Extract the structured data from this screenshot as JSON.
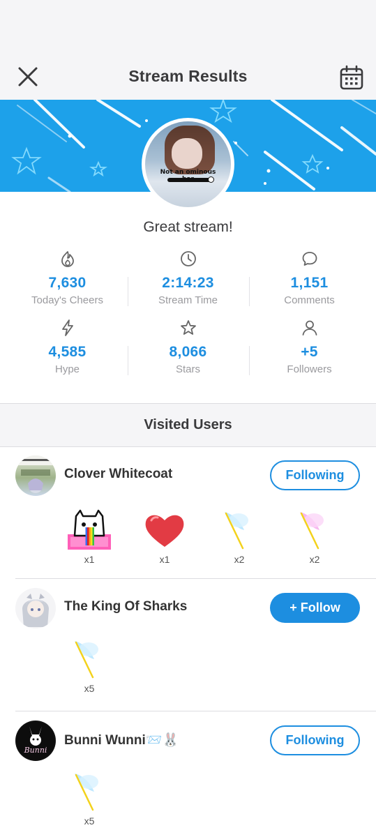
{
  "header": {
    "title": "Stream Results",
    "close_icon": "close-icon",
    "calendar_icon": "calendar-icon"
  },
  "banner": {
    "color": "#1da1ea"
  },
  "streamer": {
    "avatar_caption": "Not an ominous bar"
  },
  "summary": {
    "message": "Great stream!"
  },
  "stats": [
    {
      "icon": "flame-icon",
      "value": "7,630",
      "label": "Today's Cheers"
    },
    {
      "icon": "clock-icon",
      "value": "2:14:23",
      "label": "Stream Time"
    },
    {
      "icon": "comment-icon",
      "value": "1,151",
      "label": "Comments"
    },
    {
      "icon": "lightning-icon",
      "value": "4,585",
      "label": "Hype"
    },
    {
      "icon": "star-icon",
      "value": "8,066",
      "label": "Stars"
    },
    {
      "icon": "person-icon",
      "value": "+5",
      "label": "Followers"
    }
  ],
  "visited": {
    "title": "Visited Users",
    "users": [
      {
        "name": "Clover Whitecoat",
        "button": "Following",
        "gifts": [
          {
            "icon": "rainbow-cat-icon",
            "count": "x1"
          },
          {
            "icon": "heart-icon",
            "count": "x1"
          },
          {
            "icon": "blue-feather-icon",
            "count": "x2"
          },
          {
            "icon": "pink-feather-icon",
            "count": "x2"
          }
        ]
      },
      {
        "name": "The King Of Sharks",
        "button": "+ Follow",
        "gifts": [
          {
            "icon": "blue-feather-icon",
            "count": "x5"
          }
        ]
      },
      {
        "name": "Bunni Wunni📨🐰",
        "button": "Following",
        "gifts": [
          {
            "icon": "blue-feather-icon",
            "count": "x5"
          }
        ]
      }
    ]
  },
  "colors": {
    "accent": "#1d8ee0",
    "muted": "#9a9a9e",
    "section_bg": "#f5f5f7"
  }
}
